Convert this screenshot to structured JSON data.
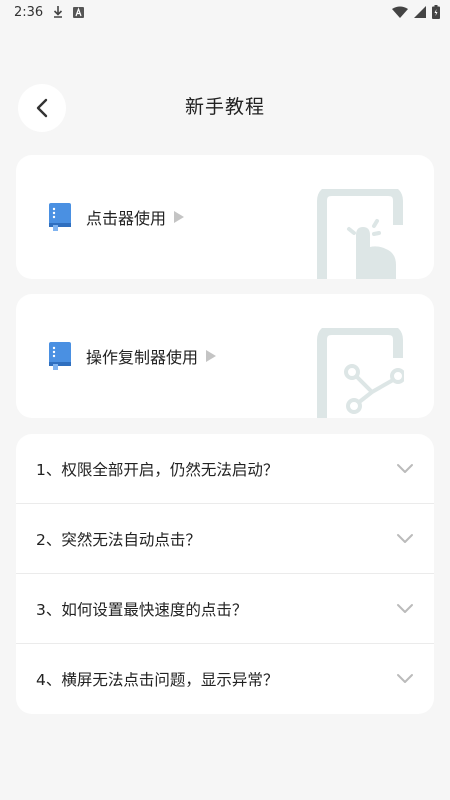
{
  "status": {
    "time": "2:36",
    "download_icon": "download-icon",
    "notification_icon": "a-badge-icon",
    "wifi_icon": "wifi-icon",
    "signal_icon": "signal-icon",
    "battery_icon": "battery-icon"
  },
  "header": {
    "title": "新手教程",
    "back_icon": "chevron-left-icon"
  },
  "cards": [
    {
      "label": "点击器使用",
      "icon": "book-icon",
      "art": "tap-hand-icon"
    },
    {
      "label": "操作复制器使用",
      "icon": "book-icon",
      "art": "share-nodes-icon"
    }
  ],
  "faq": [
    {
      "text": "1、权限全部开启，仍然无法启动？"
    },
    {
      "text": "2、突然无法自动点击？"
    },
    {
      "text": "3、如何设置最快速度的点击？"
    },
    {
      "text": "4、横屏无法点击问题，显示异常？"
    }
  ],
  "colors": {
    "accent": "#4a90e2",
    "art": "#dde6e6",
    "background": "#f6f6f6"
  }
}
